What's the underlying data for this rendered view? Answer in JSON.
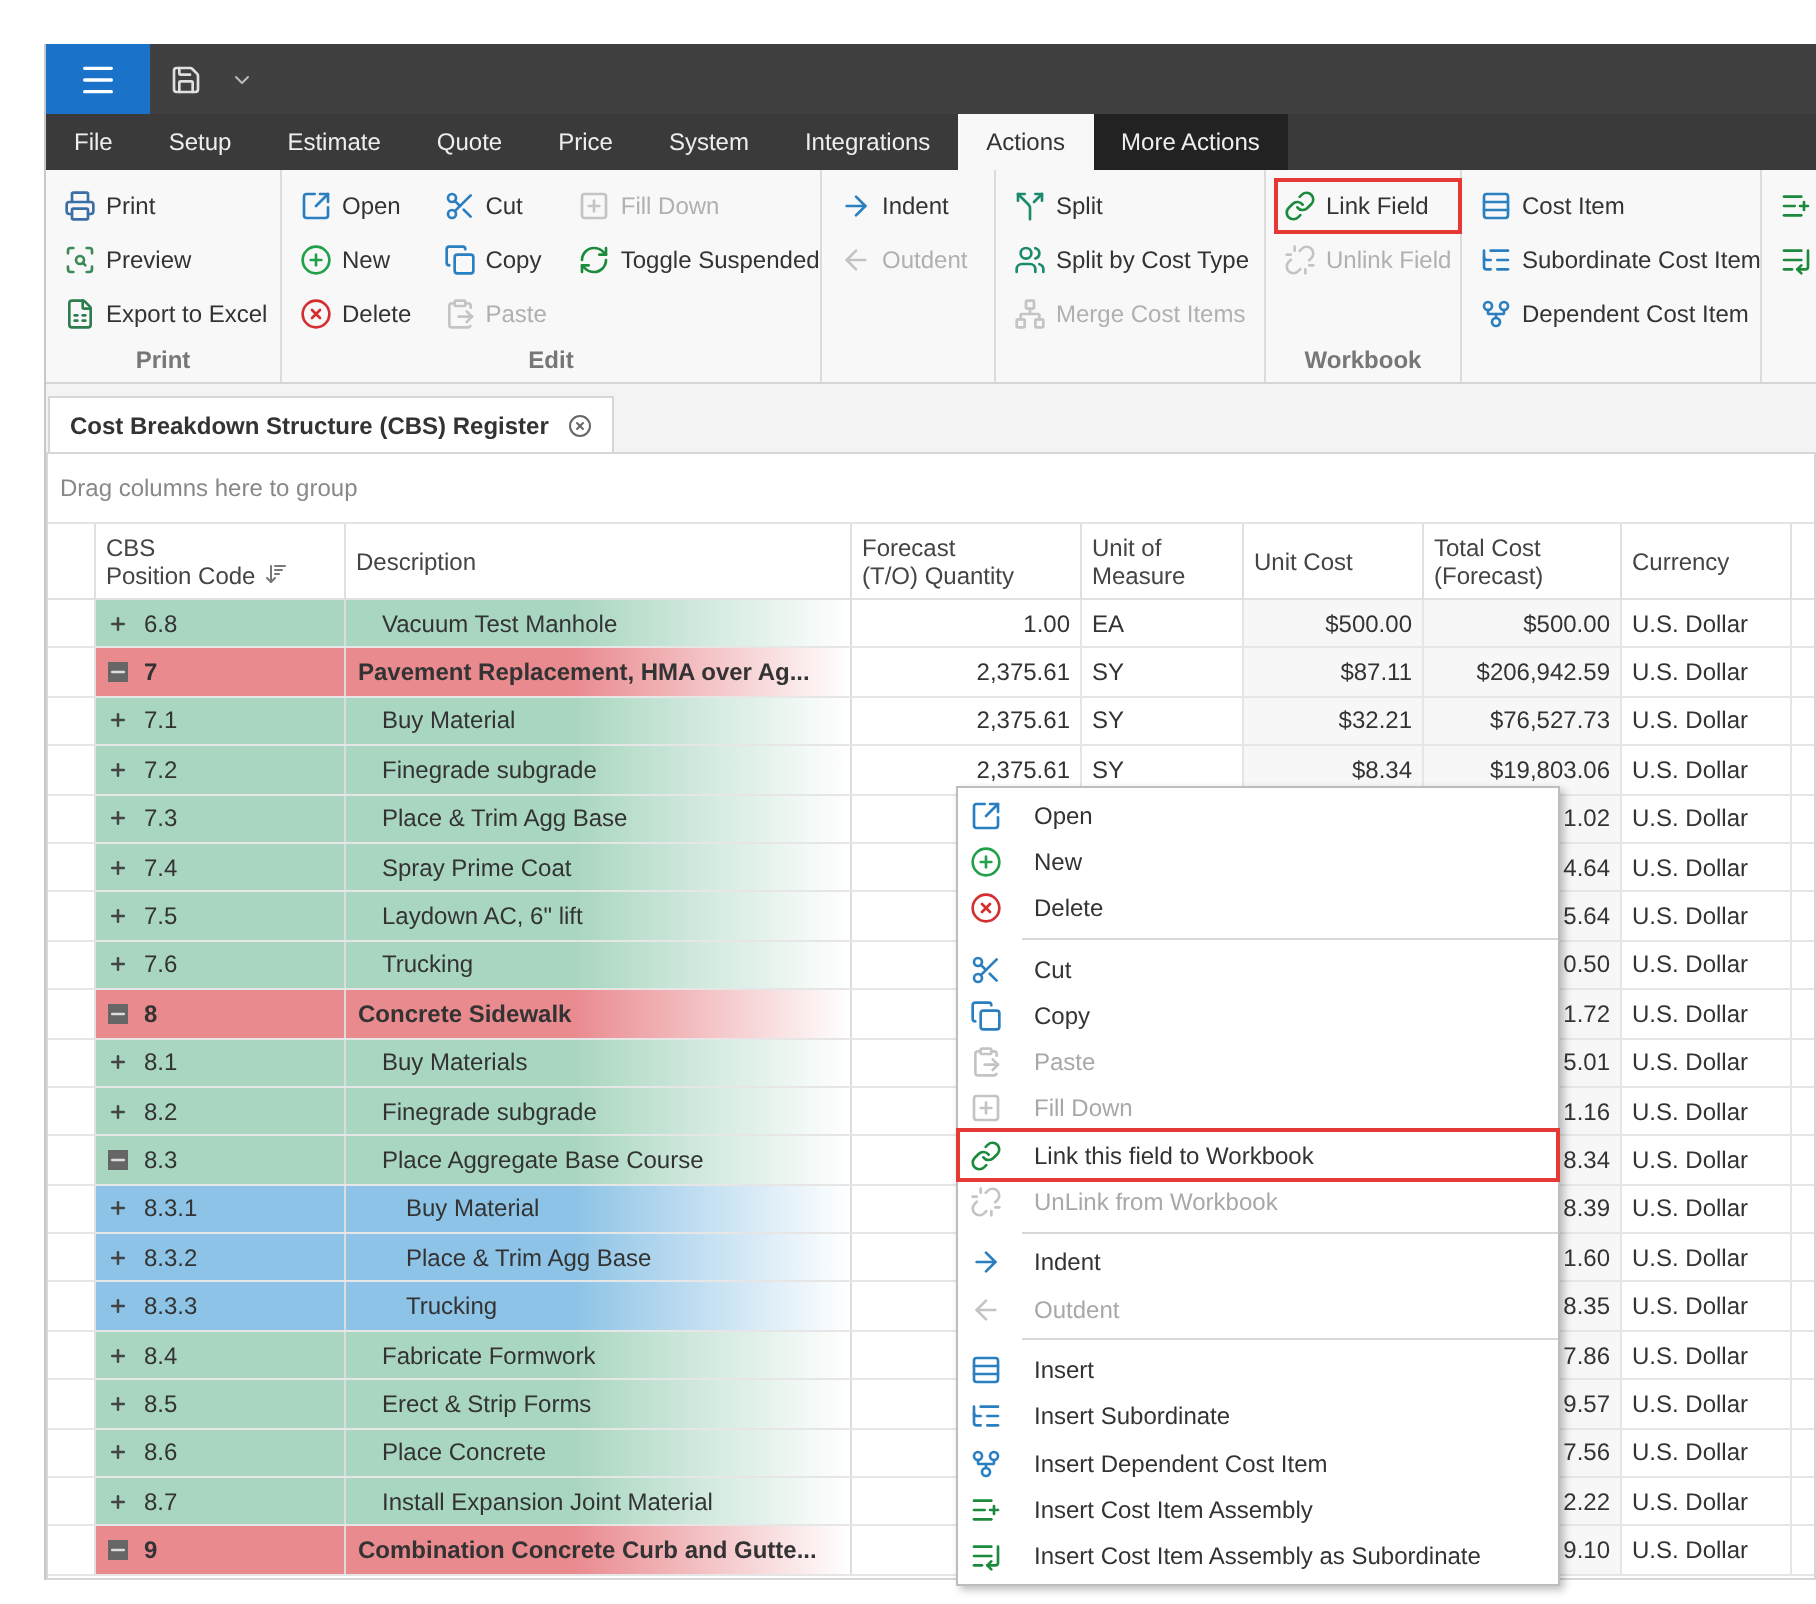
{
  "ribbon_tabs": [
    {
      "label": "File",
      "selected": false,
      "highlighted": false
    },
    {
      "label": "Setup",
      "selected": false,
      "highlighted": false
    },
    {
      "label": "Estimate",
      "selected": false,
      "highlighted": false
    },
    {
      "label": "Quote",
      "selected": false,
      "highlighted": false
    },
    {
      "label": "Price",
      "selected": false,
      "highlighted": false
    },
    {
      "label": "System",
      "selected": false,
      "highlighted": false
    },
    {
      "label": "Integrations",
      "selected": false,
      "highlighted": false
    },
    {
      "label": "Actions",
      "selected": true,
      "highlighted": false
    },
    {
      "label": "More Actions",
      "selected": false,
      "highlighted": true
    }
  ],
  "ribbon_groups": [
    {
      "label": "Print",
      "items": [
        {
          "label": "Print",
          "disabled": false,
          "outlined": false
        },
        {
          "label": "Preview",
          "disabled": false,
          "outlined": false
        },
        {
          "label": "Export to Excel",
          "disabled": false,
          "outlined": false
        }
      ]
    },
    {
      "label": "Edit",
      "items": [
        {
          "label": "Open",
          "disabled": false,
          "outlined": false
        },
        {
          "label": "New",
          "disabled": false,
          "outlined": false
        },
        {
          "label": "Delete",
          "disabled": false,
          "outlined": false
        },
        {
          "label": "Cut",
          "disabled": false,
          "outlined": false
        },
        {
          "label": "Copy",
          "disabled": false,
          "outlined": false
        },
        {
          "label": "Paste",
          "disabled": true,
          "outlined": false
        },
        {
          "label": "Fill Down",
          "disabled": true,
          "outlined": false
        },
        {
          "label": "Toggle Suspended",
          "disabled": false,
          "outlined": false
        }
      ]
    },
    {
      "items": [
        {
          "label": "Indent",
          "disabled": false,
          "outlined": false
        },
        {
          "label": "Outdent",
          "disabled": true,
          "outlined": false
        }
      ]
    },
    {
      "items": [
        {
          "label": "Split",
          "disabled": false,
          "outlined": false
        },
        {
          "label": "Split by Cost Type",
          "disabled": false,
          "outlined": false
        },
        {
          "label": "Merge Cost Items",
          "disabled": true,
          "outlined": false
        }
      ]
    },
    {
      "label": "Workbook",
      "items": [
        {
          "label": "Link Field",
          "disabled": false,
          "outlined": true
        },
        {
          "label": "Unlink Field",
          "disabled": true,
          "outlined": false
        }
      ]
    },
    {
      "items": [
        {
          "label": "Cost Item",
          "disabled": false,
          "outlined": false
        },
        {
          "label": "Subordinate Cost Item",
          "disabled": false,
          "outlined": false
        },
        {
          "label": "Dependent Cost Item",
          "disabled": false,
          "outlined": false
        }
      ]
    },
    {
      "items": [
        {
          "disabled": false,
          "outlined": false
        },
        {
          "disabled": false,
          "outlined": false
        }
      ]
    }
  ],
  "document_tab": {
    "title": "Cost Breakdown Structure (CBS) Register"
  },
  "group_panel": {
    "placeholder": "Drag columns here to group"
  },
  "table": {
    "columns": [
      "CBS\nPosition Code",
      "Description",
      "Forecast\n(T/O) Quantity",
      "Unit of\nMeasure",
      "Unit Cost",
      "Total Cost\n(Forecast)",
      "Currency"
    ],
    "rows": [
      {
        "kind": "item",
        "expanded": false,
        "color": "#a9d6c0",
        "code": "6.8",
        "description": "Vacuum Test Manhole",
        "quantity": "1.00",
        "unit": "EA",
        "unit_cost": "$500.00",
        "total": "$500.00",
        "currency": "U.S. Dollar"
      },
      {
        "kind": "group",
        "expanded": true,
        "color": "#e98a8f",
        "code": "7",
        "description": "Pavement Replacement, HMA over Ag...",
        "quantity": "2,375.61",
        "unit": "SY",
        "unit_cost": "$87.11",
        "total": "$206,942.59",
        "currency": "U.S. Dollar"
      },
      {
        "kind": "item",
        "expanded": false,
        "color": "#a9d6c0",
        "code": "7.1",
        "description": "Buy Material",
        "quantity": "2,375.61",
        "unit": "SY",
        "unit_cost": "$32.21",
        "total": "$76,527.73",
        "currency": "U.S. Dollar"
      },
      {
        "kind": "item",
        "expanded": false,
        "color": "#a9d6c0",
        "code": "7.2",
        "description": "Finegrade subgrade",
        "quantity": "2,375.61",
        "unit": "SY",
        "unit_cost": "$8.34",
        "total": "$19,803.06",
        "currency": "U.S. Dollar"
      },
      {
        "kind": "item",
        "expanded": false,
        "color": "#a9d6c0",
        "code": "7.3",
        "description": "Place & Trim Agg Base",
        "total": "1.02",
        "currency": "U.S. Dollar"
      },
      {
        "kind": "item",
        "expanded": false,
        "color": "#a9d6c0",
        "code": "7.4",
        "description": "Spray Prime Coat",
        "total": "4.64",
        "currency": "U.S. Dollar"
      },
      {
        "kind": "item",
        "expanded": false,
        "color": "#a9d6c0",
        "code": "7.5",
        "description": "Laydown AC, 6\" lift",
        "total": "5.64",
        "currency": "U.S. Dollar"
      },
      {
        "kind": "item",
        "expanded": false,
        "color": "#a9d6c0",
        "code": "7.6",
        "description": "Trucking",
        "total": "0.50",
        "currency": "U.S. Dollar"
      },
      {
        "kind": "group",
        "expanded": true,
        "color": "#e98a8f",
        "code": "8",
        "description": "Concrete Sidewalk",
        "total": "1.72",
        "currency": "U.S. Dollar"
      },
      {
        "kind": "item",
        "expanded": false,
        "color": "#a9d6c0",
        "code": "8.1",
        "description": "Buy Materials",
        "total": "5.01",
        "currency": "U.S. Dollar"
      },
      {
        "kind": "item",
        "expanded": false,
        "color": "#a9d6c0",
        "code": "8.2",
        "description": "Finegrade subgrade",
        "total": "1.16",
        "currency": "U.S. Dollar"
      },
      {
        "kind": "item",
        "expanded": true,
        "color": "#a9d6c0",
        "code": "8.3",
        "description": "Place Aggregate Base Course",
        "total": "8.34",
        "currency": "U.S. Dollar"
      },
      {
        "kind": "subitem",
        "expanded": false,
        "color": "#8dc3e6",
        "code": "8.3.1",
        "description": "Buy Material",
        "total": "8.39",
        "currency": "U.S. Dollar"
      },
      {
        "kind": "subitem",
        "expanded": false,
        "color": "#8dc3e6",
        "code": "8.3.2",
        "description": "Place & Trim Agg Base",
        "total": "1.60",
        "currency": "U.S. Dollar"
      },
      {
        "kind": "subitem",
        "expanded": false,
        "color": "#8dc3e6",
        "code": "8.3.3",
        "description": "Trucking",
        "total": "8.35",
        "currency": "U.S. Dollar"
      },
      {
        "kind": "item",
        "expanded": false,
        "color": "#a9d6c0",
        "code": "8.4",
        "description": "Fabricate Formwork",
        "total": "7.86",
        "currency": "U.S. Dollar"
      },
      {
        "kind": "item",
        "expanded": false,
        "color": "#a9d6c0",
        "code": "8.5",
        "description": "Erect & Strip Forms",
        "total": "9.57",
        "currency": "U.S. Dollar"
      },
      {
        "kind": "item",
        "expanded": false,
        "color": "#a9d6c0",
        "code": "8.6",
        "description": "Place Concrete",
        "total": "7.56",
        "currency": "U.S. Dollar"
      },
      {
        "kind": "item",
        "expanded": false,
        "color": "#a9d6c0",
        "code": "8.7",
        "description": "Install Expansion Joint Material",
        "total": "2.22",
        "currency": "U.S. Dollar"
      },
      {
        "kind": "group",
        "expanded": true,
        "color": "#e98a8f",
        "code": "9",
        "description": "Combination Concrete Curb and Gutte...",
        "total": "9.10",
        "currency": "U.S. Dollar"
      }
    ]
  },
  "context_menu": {
    "items": [
      {
        "kind": "item",
        "label": "Open",
        "disabled": false,
        "outlined": false
      },
      {
        "kind": "item",
        "label": "New",
        "disabled": false,
        "outlined": false
      },
      {
        "kind": "item",
        "label": "Delete",
        "disabled": false,
        "outlined": false
      },
      {
        "kind": "separator"
      },
      {
        "kind": "item",
        "label": "Cut",
        "disabled": false,
        "outlined": false
      },
      {
        "kind": "item",
        "label": "Copy",
        "disabled": false,
        "outlined": false
      },
      {
        "kind": "item",
        "label": "Paste",
        "disabled": true,
        "outlined": false
      },
      {
        "kind": "item",
        "label": "Fill Down",
        "disabled": true,
        "outlined": false
      },
      {
        "kind": "item",
        "label": "Link this field to Workbook",
        "disabled": false,
        "outlined": true
      },
      {
        "kind": "item",
        "label": "UnLink from Workbook",
        "disabled": true,
        "outlined": false
      },
      {
        "kind": "separator"
      },
      {
        "kind": "item",
        "label": "Indent",
        "disabled": false,
        "outlined": false
      },
      {
        "kind": "item",
        "label": "Outdent",
        "disabled": true,
        "outlined": false
      },
      {
        "kind": "separator"
      },
      {
        "kind": "item",
        "label": "Insert",
        "disabled": false,
        "outlined": false
      },
      {
        "kind": "item",
        "label": "Insert Subordinate",
        "disabled": false,
        "outlined": false
      },
      {
        "kind": "item",
        "label": "Insert Dependent Cost Item",
        "disabled": false,
        "outlined": false
      },
      {
        "kind": "item",
        "label": "Insert Cost Item Assembly",
        "disabled": false,
        "outlined": false
      },
      {
        "kind": "item",
        "label": "Insert Cost Item Assembly as Subordinate",
        "disabled": false,
        "outlined": false
      }
    ]
  }
}
